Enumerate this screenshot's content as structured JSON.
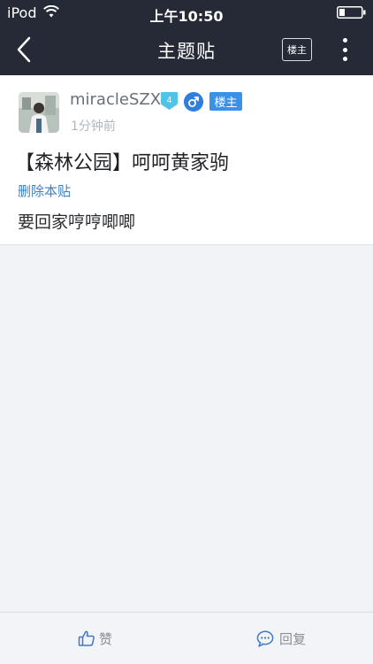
{
  "status_bar": {
    "carrier": "iPod",
    "time": "上午10:50"
  },
  "nav": {
    "title": "主题贴",
    "op_only_label": "楼主"
  },
  "post": {
    "username": "miracleSZX",
    "level": "4",
    "op_badge": "楼主",
    "time_ago": "1分钟前",
    "title": "【森林公园】呵呵黄家驹",
    "delete_label": "删除本贴",
    "body": "要回家哼哼唧唧"
  },
  "bottom_bar": {
    "like_label": "赞",
    "reply_label": "回复"
  },
  "colors": {
    "topbar": "#252a36",
    "page_bg": "#f2f3f7",
    "link_blue": "#3b7fd0",
    "badge_blue": "#3b90e8",
    "level_cyan": "#4fc4e6"
  }
}
